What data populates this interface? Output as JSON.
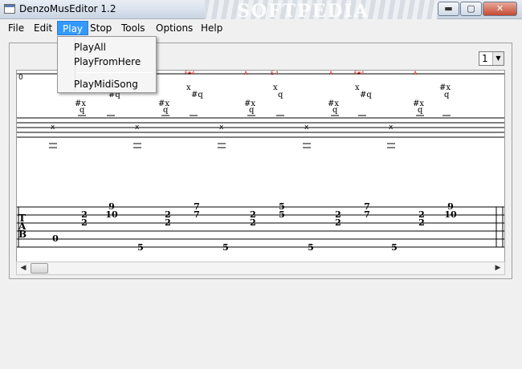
{
  "window": {
    "title": "DenzoMusEditor 1.2",
    "watermark": "SOFTPEDIA"
  },
  "window_buttons": {
    "minimize": "▬",
    "maximize": "▢",
    "close": "✕"
  },
  "menubar": [
    "File",
    "Edit",
    "Play",
    "Stop",
    "Tools",
    "Options",
    "Help"
  ],
  "play_menu": [
    "PlayAll",
    "PlayFromHere",
    "PlayMidiSong"
  ],
  "measure_select": {
    "value": "1"
  },
  "score": {
    "measure_number": "0",
    "annotations": [
      "F#4",
      "A",
      "E 4",
      "A",
      "F#4",
      "A"
    ],
    "tab_clef": [
      "T",
      "A",
      "B"
    ],
    "treble_notes": [
      {
        "acc": "#x",
        "head": "q"
      },
      {
        "acc": "x",
        "head": "#q"
      },
      {
        "acc": "#x",
        "head": "q"
      },
      {
        "acc": "x",
        "head": "#q"
      },
      {
        "acc": "#x",
        "head": "q"
      },
      {
        "acc": "x",
        "head": "q"
      },
      {
        "acc": "#x",
        "head": "q"
      },
      {
        "acc": "x",
        "head": "#q"
      },
      {
        "acc": "#x",
        "head": "q"
      },
      {
        "acc": "#x",
        "head": "q"
      }
    ],
    "bass_mark": "x",
    "tab_groups": [
      {
        "top": "",
        "mid": "",
        "low": "0"
      },
      {
        "top": "2",
        "mid": "2"
      },
      {
        "top": "9",
        "mid": "10"
      },
      {
        "low": "5"
      },
      {
        "top": "2",
        "mid": "2"
      },
      {
        "top": "7",
        "mid": "7"
      },
      {
        "low": "5"
      },
      {
        "top": "2",
        "mid": "2"
      },
      {
        "top": "5",
        "mid": "5"
      },
      {
        "low": "5"
      },
      {
        "top": "2",
        "mid": "2"
      },
      {
        "top": "7",
        "mid": "7"
      },
      {
        "low": "5"
      },
      {
        "top": "2",
        "mid": "2"
      },
      {
        "top": "9",
        "mid": "10"
      }
    ]
  },
  "scrollbar": {
    "left_arrow": "◀",
    "right_arrow": "▶"
  }
}
